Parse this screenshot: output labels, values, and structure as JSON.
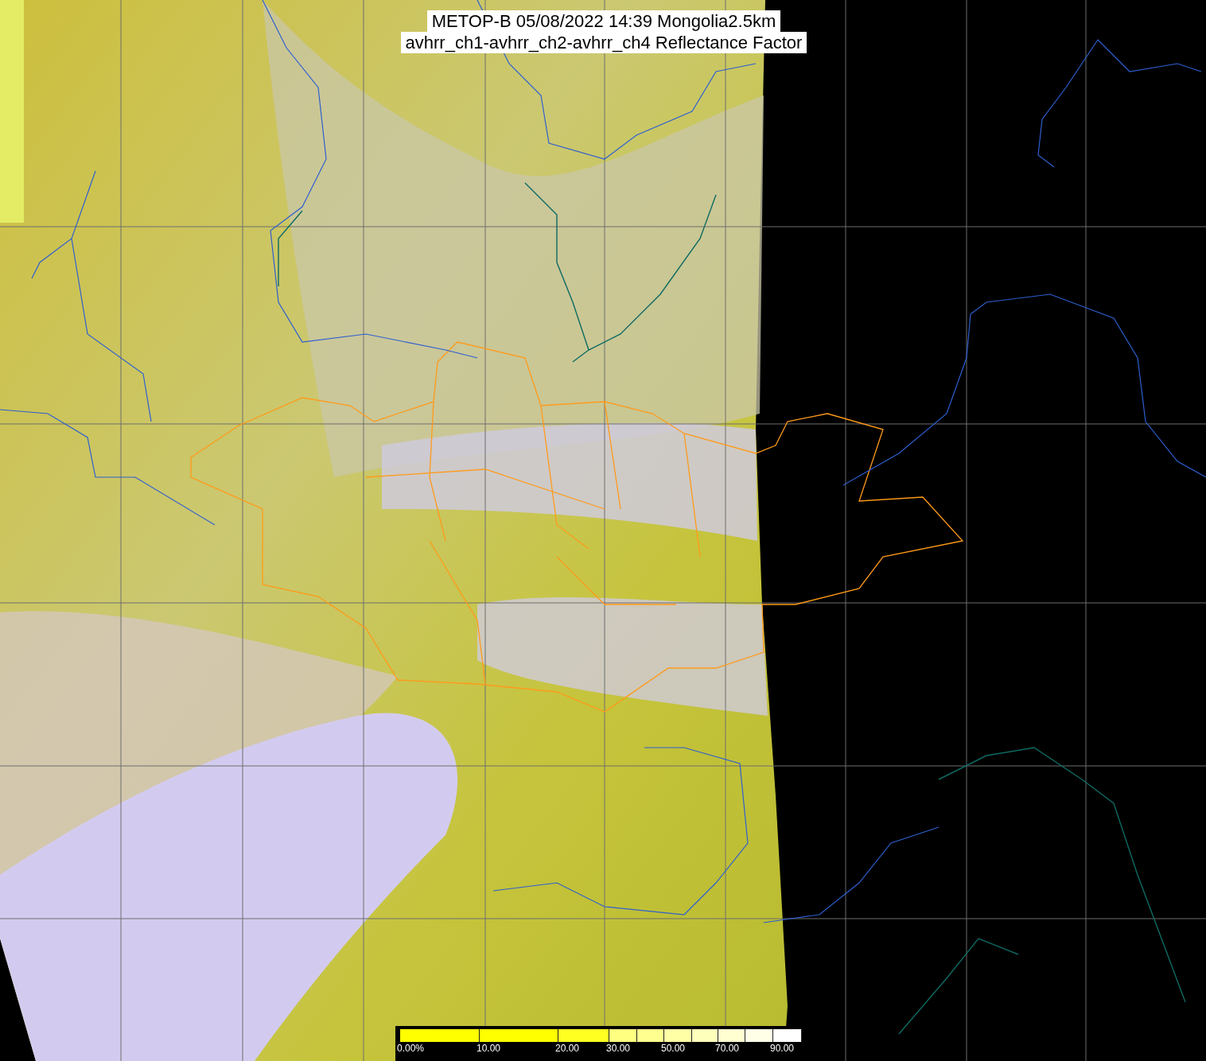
{
  "title": {
    "lines": [
      "METOP-B 05/08/2022 14:39 Mongolia2.5km",
      "avhrr_ch1-avhrr_ch2-avhrr_ch4 Reflectance Factor"
    ]
  },
  "legend": {
    "segments": [
      {
        "color": "#ffff00",
        "label": "0.00%"
      },
      {
        "color": "#ffff00",
        "label": "10.00"
      },
      {
        "color": "#ffff22",
        "label": "20.00"
      },
      {
        "color": "#ffff80",
        "label": "30.00"
      },
      {
        "color": "#ffff90"
      },
      {
        "color": "#ffffa6",
        "label": "50.00"
      },
      {
        "color": "#ffffbc"
      },
      {
        "color": "#ffffd2",
        "label": "70.00"
      },
      {
        "color": "#ffffe8"
      },
      {
        "color": "#ffffff",
        "label": "90.00"
      }
    ]
  }
}
